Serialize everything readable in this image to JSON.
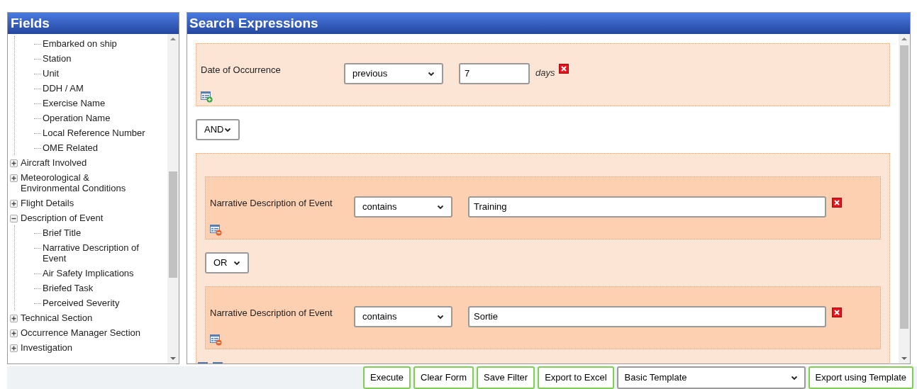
{
  "fields_panel": {
    "title": "Fields",
    "orphan_children": [
      {
        "label": "Embarked on ship"
      },
      {
        "label": "Station"
      },
      {
        "label": "Unit"
      },
      {
        "label": "DDH / AM"
      },
      {
        "label": "Exercise Name"
      },
      {
        "label": "Operation Name"
      },
      {
        "label": "Local Reference Number"
      },
      {
        "label": "OME Related"
      }
    ],
    "items": [
      {
        "label": "Aircraft Involved",
        "expanded": false
      },
      {
        "label": "Meteorological & Environmental Conditions",
        "expanded": false
      },
      {
        "label": "Flight Details",
        "expanded": false
      },
      {
        "label": "Description of Event",
        "expanded": true,
        "children": [
          {
            "label": "Brief Title"
          },
          {
            "label": "Narrative Description of Event"
          },
          {
            "label": "Air Safety Implications"
          },
          {
            "label": "Briefed Task"
          },
          {
            "label": "Perceived Severity"
          }
        ]
      },
      {
        "label": "Technical Section",
        "expanded": false
      },
      {
        "label": "Occurrence Manager Section",
        "expanded": false
      },
      {
        "label": "Investigation",
        "expanded": false
      }
    ]
  },
  "search_panel": {
    "title": "Search Expressions",
    "expressions": [
      {
        "kind": "condition",
        "field": "Date of Occurrence",
        "operator": "previous",
        "value": "7",
        "unit": "days"
      },
      {
        "kind": "logic",
        "value": "AND"
      },
      {
        "kind": "group",
        "items": [
          {
            "kind": "condition",
            "field": "Narrative Description of Event",
            "operator": "contains",
            "value": "Training"
          },
          {
            "kind": "logic",
            "value": "OR"
          },
          {
            "kind": "condition",
            "field": "Narrative Description of Event",
            "operator": "contains",
            "value": "Sortie"
          }
        ]
      }
    ]
  },
  "buttons": [
    {
      "kind": "button",
      "label": "Execute"
    },
    {
      "kind": "button",
      "label": "Clear Form"
    },
    {
      "kind": "button",
      "label": "Save Filter"
    },
    {
      "kind": "button",
      "label": "Export to Excel"
    },
    {
      "kind": "select",
      "label": "Basic Template"
    },
    {
      "kind": "button",
      "label": "Export using Template"
    }
  ]
}
